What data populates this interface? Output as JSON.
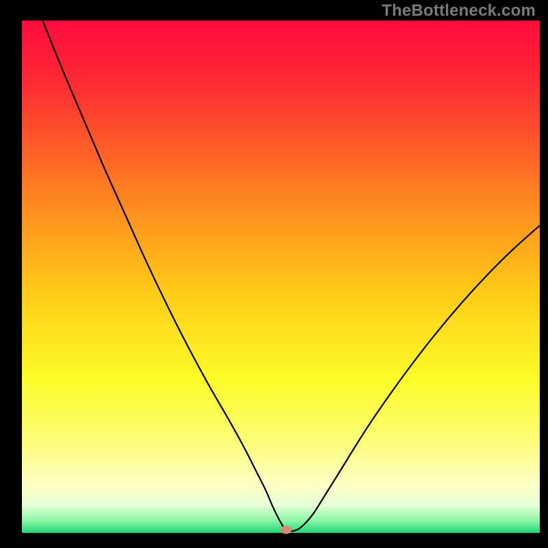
{
  "watermark": "TheBottleneck.com",
  "plot": {
    "margin_left": 32,
    "margin_right": 12,
    "margin_top": 30,
    "margin_bottom": 22,
    "gradient_stops": [
      {
        "offset": 0.0,
        "color": "#ff0a3c"
      },
      {
        "offset": 0.12,
        "color": "#ff2a34"
      },
      {
        "offset": 0.32,
        "color": "#ff7a22"
      },
      {
        "offset": 0.52,
        "color": "#ffc817"
      },
      {
        "offset": 0.7,
        "color": "#fcfc28"
      },
      {
        "offset": 0.82,
        "color": "#fdfd77"
      },
      {
        "offset": 0.9,
        "color": "#feffc0"
      },
      {
        "offset": 0.945,
        "color": "#e8ffd8"
      },
      {
        "offset": 0.975,
        "color": "#90f7a8"
      },
      {
        "offset": 1.0,
        "color": "#1fd67a"
      }
    ],
    "curve_stroke": "#000000",
    "curve_width": 2.2,
    "marker": {
      "fill": "#d58a76",
      "rx": 8,
      "ry": 6
    }
  },
  "chart_data": {
    "type": "line",
    "title": "",
    "xlabel": "",
    "ylabel": "",
    "xlim": [
      0,
      100
    ],
    "ylim": [
      0,
      100
    ],
    "optimum_x": 51,
    "series": [
      {
        "name": "bottleneck",
        "x": [
          4,
          8,
          12,
          16,
          20,
          24,
          28,
          32,
          36,
          40,
          43,
          45,
          47,
          48.5,
          50,
          51,
          52.5,
          54,
          56,
          58,
          62,
          66,
          70,
          75,
          80,
          85,
          90,
          95,
          100
        ],
        "values": [
          100,
          90,
          80.5,
          71,
          62,
          53,
          44.5,
          36.5,
          29,
          22,
          16.5,
          12.5,
          8.5,
          5,
          2,
          0.6,
          0.4,
          1.2,
          3.4,
          6.5,
          13,
          19.5,
          25.5,
          32.5,
          39,
          45,
          50.5,
          55.5,
          60
        ]
      }
    ]
  }
}
